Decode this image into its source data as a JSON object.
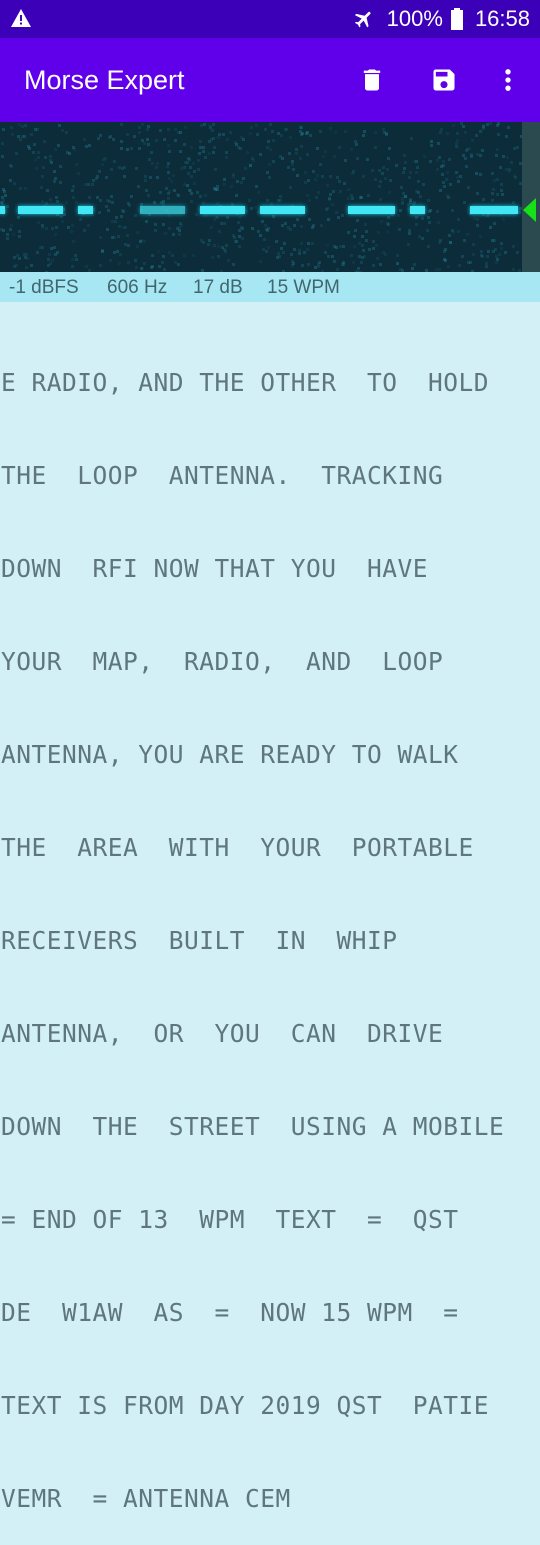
{
  "status_bar": {
    "warning_icon": "warning-triangle-icon",
    "airplane_icon": "airplane-mode-icon",
    "battery_percent": "100%",
    "battery_icon": "battery-full-icon",
    "time": "16:58"
  },
  "app_bar": {
    "title": "Morse Expert",
    "actions": [
      {
        "name": "delete",
        "icon": "trash-icon"
      },
      {
        "name": "save",
        "icon": "floppy-disk-icon"
      },
      {
        "name": "more",
        "icon": "more-vertical-icon"
      }
    ]
  },
  "waterfall": {
    "marker_color": "#16e016",
    "signal_color": "#3fe8f4"
  },
  "info_bar": {
    "level": "-1 dBFS",
    "frequency": "606 Hz",
    "snr": "17 dB",
    "speed": "15 WPM"
  },
  "decoded_text": {
    "lines": [
      "E RADIO, AND THE OTHER  TO  HOLD",
      "THE  LOOP  ANTENNA.  TRACKING",
      "DOWN  RFI NOW THAT YOU  HAVE",
      "YOUR  MAP,  RADIO,  AND  LOOP",
      "ANTENNA, YOU ARE READY TO WALK",
      "THE  AREA  WITH  YOUR  PORTABLE",
      "RECEIVERS  BUILT  IN  WHIP",
      "ANTENNA,  OR  YOU  CAN  DRIVE",
      "DOWN  THE  STREET  USING A MOBILE",
      "= END OF 13  WPM  TEXT  =  QST",
      "DE  W1AW  AS  =  NOW 15 WPM  =",
      "TEXT IS FROM DAY 2019 QST  PATIE",
      "VEMR  = ANTENNA CEM"
    ]
  }
}
